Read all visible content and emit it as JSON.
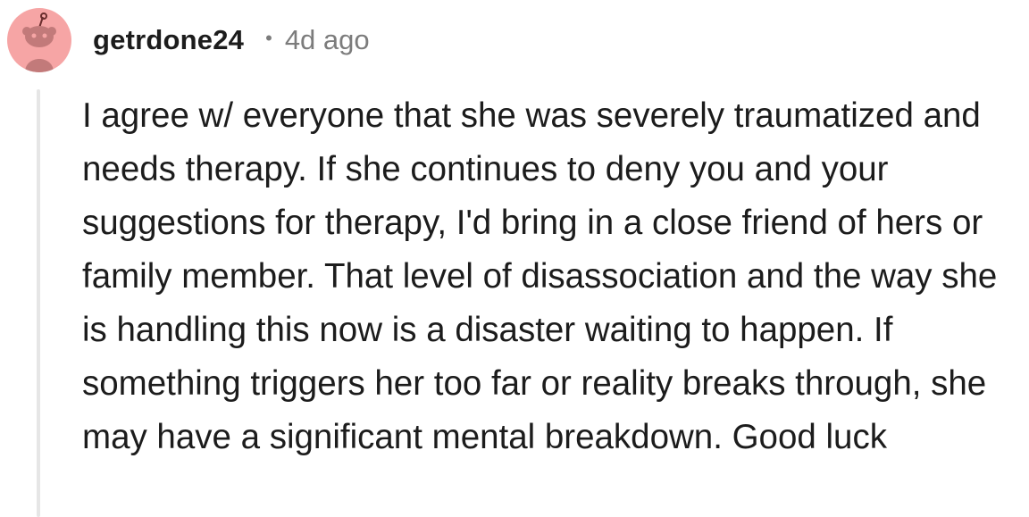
{
  "comment": {
    "avatar_icon": "reddit-snoo-avatar-icon",
    "username": "getrdone24",
    "separator": "•",
    "timestamp": "4d ago",
    "body": "I agree w/ everyone that she was severely traumatized and needs therapy. If she continues to deny you and your suggestions for therapy, I'd bring in a close friend of hers or family member. That level of disassociation and the way she is handling this now is a disaster waiting to happen. If something triggers her too far or reality breaks through, she may have a significant mental breakdown. Good luck"
  },
  "colors": {
    "avatar_background": "#f6a5a5",
    "thread_line": "#e6e6e6",
    "meta_text": "#7c7c7c",
    "body_text": "#1c1c1c"
  }
}
